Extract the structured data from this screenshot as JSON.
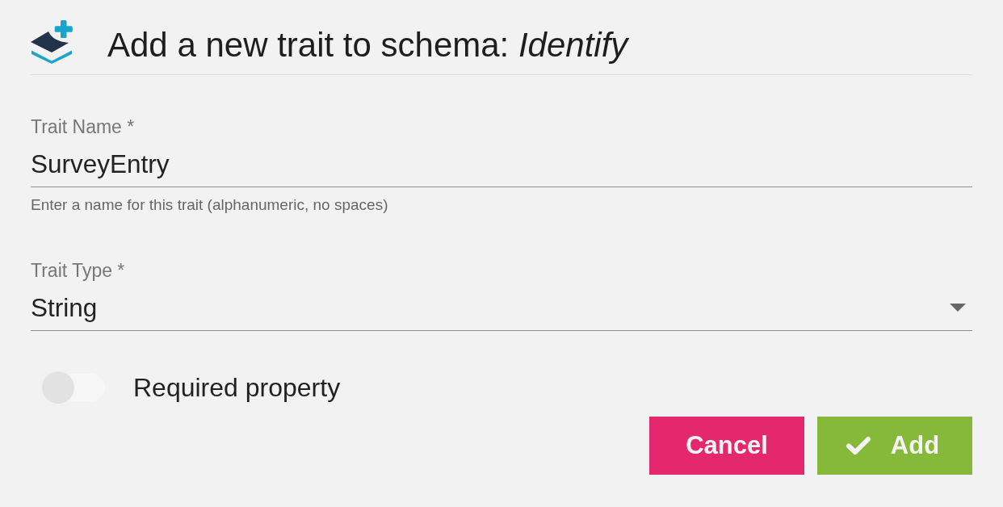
{
  "dialog": {
    "title": "Add a new trait to schema: *Identify*"
  },
  "fields": [
    {
      "kind": "text",
      "label": "Trait Name *",
      "value": "SurveyEntry",
      "helper": "Enter a name for this trait (alphanumeric, no spaces)"
    },
    {
      "kind": "select",
      "label": "Trait Type *",
      "value": "String"
    }
  ],
  "toggle": {
    "label": "Required property",
    "on": false
  },
  "buttons": [
    {
      "kind": "cancel",
      "label": "Cancel"
    },
    {
      "kind": "confirm",
      "label": "Add"
    }
  ]
}
